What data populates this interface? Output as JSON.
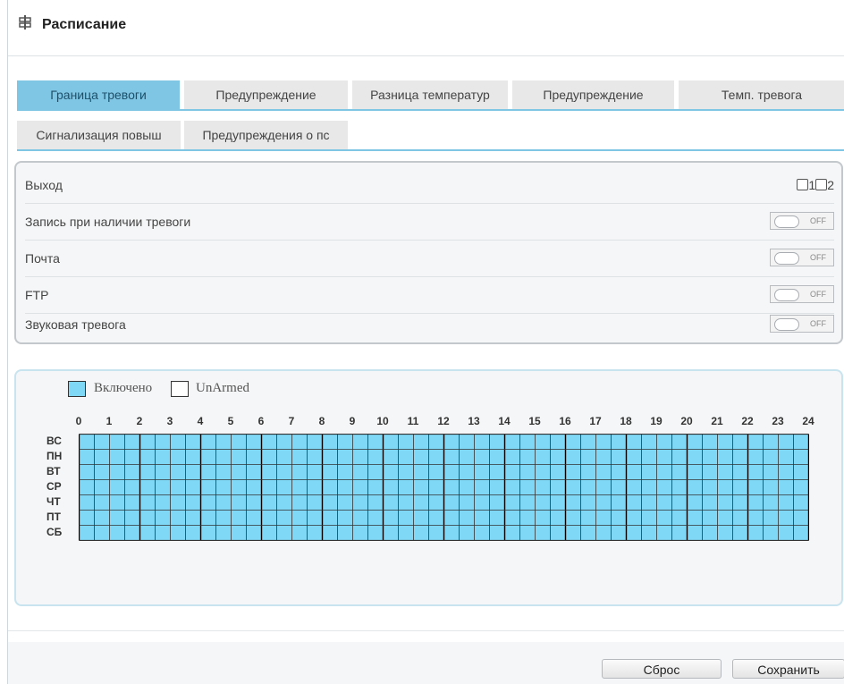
{
  "page": {
    "title": "Расписание",
    "icon": "schedule-icon"
  },
  "tabs_row1": [
    {
      "label": "Граница тревоги",
      "active": true
    },
    {
      "label": "Предупреждение",
      "active": false
    },
    {
      "label": "Разница температур",
      "active": false
    },
    {
      "label": "Предупреждение",
      "active": false
    },
    {
      "label": "Темп. тревога",
      "active": false
    }
  ],
  "tabs_row2": [
    {
      "label": "Сигнализация повыш"
    },
    {
      "label": "Предупреждения о пс"
    }
  ],
  "settings": {
    "output": {
      "label": "Выход",
      "checkbox1": "1",
      "checkbox2": "2",
      "checked1": false,
      "checked2": false
    },
    "rows": [
      {
        "label": "Запись при наличии тревоги",
        "toggle_text": "OFF"
      },
      {
        "label": "Почта",
        "toggle_text": "OFF"
      },
      {
        "label": "FTP",
        "toggle_text": "OFF"
      },
      {
        "label": "Звуковая тревога",
        "toggle_text": "OFF"
      }
    ]
  },
  "schedule": {
    "legend": {
      "armed": "Включено",
      "unarmed": "UnArmed"
    },
    "hours": [
      "0",
      "1",
      "2",
      "3",
      "4",
      "5",
      "6",
      "7",
      "8",
      "9",
      "10",
      "11",
      "12",
      "13",
      "14",
      "15",
      "16",
      "17",
      "18",
      "19",
      "20",
      "21",
      "22",
      "23",
      "24"
    ],
    "days": [
      "ВС",
      "ПН",
      "ВТ",
      "СР",
      "ЧТ",
      "ПТ",
      "СБ"
    ],
    "armed_fraction": 1.0,
    "colors": {
      "armed": "#7fd8f6",
      "unarmed": "#ffffff",
      "line": "#333333",
      "hour_line": "#000000"
    }
  },
  "buttons": {
    "reset": "Сброс",
    "save": "Сохранить"
  }
}
